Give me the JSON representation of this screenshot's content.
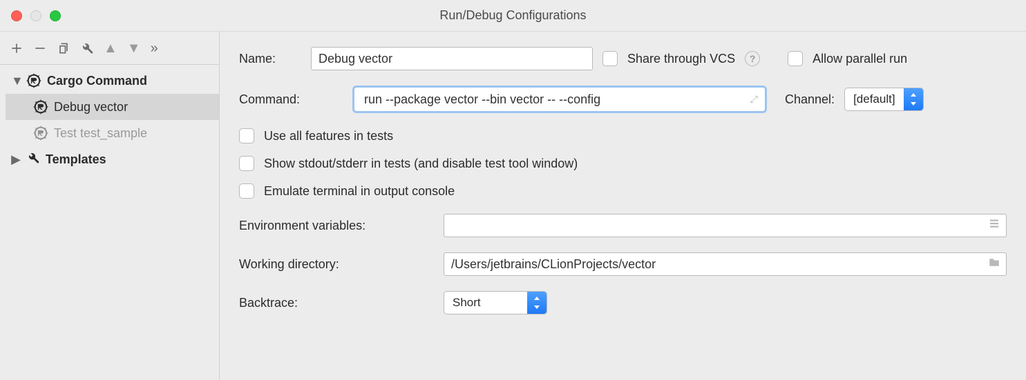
{
  "window": {
    "title": "Run/Debug Configurations"
  },
  "sidebar": {
    "nodes": [
      {
        "id": "cargo-command",
        "label": "Cargo Command",
        "type": "group",
        "expanded": true
      },
      {
        "id": "debug-vector",
        "label": "Debug vector",
        "type": "rust-run",
        "selected": true,
        "parent": "cargo-command"
      },
      {
        "id": "test-sample",
        "label": "Test test_sample",
        "type": "rust-run",
        "muted": true,
        "parent": "cargo-command"
      },
      {
        "id": "templates",
        "label": "Templates",
        "type": "group",
        "expanded": false
      }
    ]
  },
  "form": {
    "name": {
      "label": "Name:",
      "value": "Debug vector"
    },
    "share": {
      "label": "Share through VCS",
      "checked": false
    },
    "parallel": {
      "label": "Allow parallel run",
      "checked": false
    },
    "command": {
      "label": "Command:",
      "value": "run --package vector --bin vector -- --config"
    },
    "channel": {
      "label": "Channel:",
      "value": "[default]"
    },
    "checks": {
      "all_features": {
        "label": "Use all features in tests",
        "checked": false
      },
      "show_std": {
        "label": "Show stdout/stderr in tests (and disable test tool window)",
        "checked": false
      },
      "emulate": {
        "label": "Emulate terminal in output console",
        "checked": false
      }
    },
    "env": {
      "label": "Environment variables:",
      "value": ""
    },
    "wd": {
      "label": "Working directory:",
      "value": "/Users/jetbrains/CLionProjects/vector"
    },
    "bt": {
      "label": "Backtrace:",
      "value": "Short"
    }
  }
}
